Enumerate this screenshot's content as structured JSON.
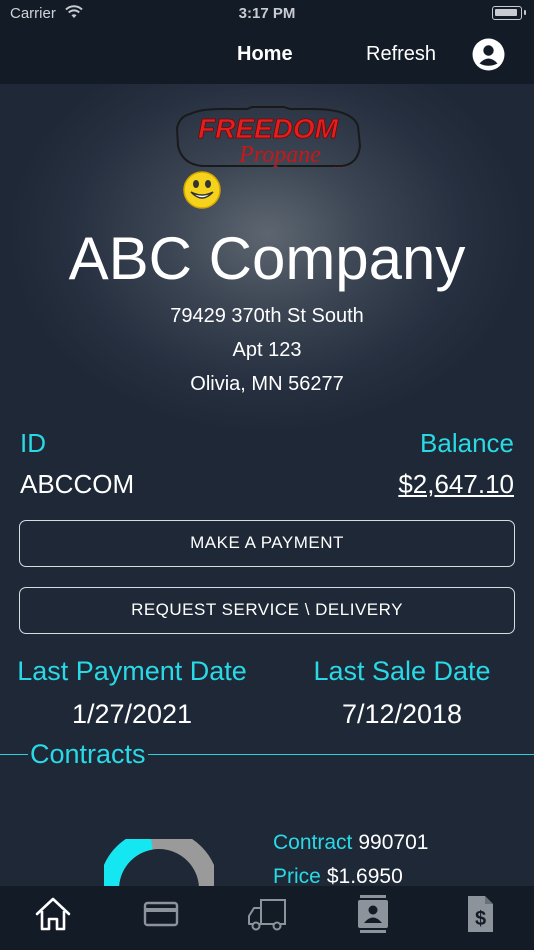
{
  "status_bar": {
    "carrier": "Carrier",
    "time": "3:17 PM"
  },
  "nav": {
    "home_label": "Home",
    "refresh_label": "Refresh",
    "profile_icon": "profile-circle-icon"
  },
  "logo": {
    "line1": "FREEDOM",
    "line2": "Propane",
    "colors": {
      "primary": "#e02020",
      "outline": "#1a1a1a",
      "smiley": "#f5d31c"
    }
  },
  "company": {
    "name": "ABC Company",
    "address_line1": "79429 370th St South",
    "address_line2": "Apt 123",
    "address_line3": "Olivia, MN 56277"
  },
  "account": {
    "id_label": "ID",
    "id_value": "ABCCOM",
    "balance_label": "Balance",
    "balance_value": "$2,647.10"
  },
  "actions": {
    "make_payment": "MAKE A PAYMENT",
    "request_service": "REQUEST SERVICE \\ DELIVERY"
  },
  "dates": {
    "last_payment_label": "Last Payment Date",
    "last_payment_value": "1/27/2021",
    "last_sale_label": "Last Sale Date",
    "last_sale_value": "7/12/2018"
  },
  "contracts": {
    "title": "Contracts",
    "contract_label": "Contract",
    "contract_value": "990701",
    "price_label": "Price",
    "price_value": "$1.6950",
    "gauge_fill_fraction": 0.45
  },
  "tabs": [
    {
      "icon": "home-icon",
      "active": true
    },
    {
      "icon": "credit-card-icon",
      "active": false
    },
    {
      "icon": "delivery-truck-icon",
      "active": false
    },
    {
      "icon": "contact-card-icon",
      "active": false
    },
    {
      "icon": "invoice-dollar-icon",
      "active": false
    }
  ],
  "colors": {
    "accent": "#29d9e6",
    "background": "#1f2836",
    "bar": "#131b26",
    "gauge_fill": "#14e6f2",
    "gauge_empty": "#9a9a9a"
  }
}
